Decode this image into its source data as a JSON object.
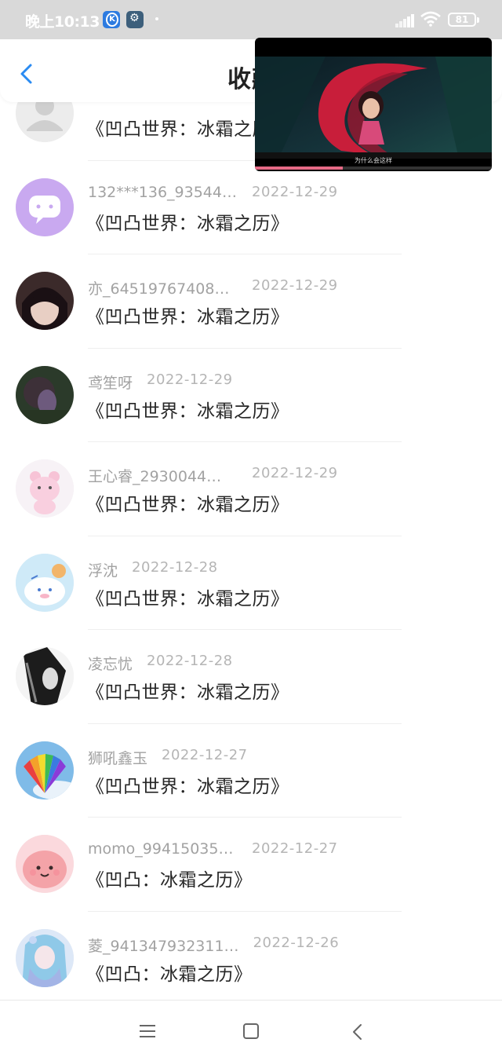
{
  "status_bar": {
    "time": "晚上10:13",
    "battery": "81",
    "icons": [
      "k-app-icon",
      "gear-app-icon",
      "dot-icon",
      "signal-icon",
      "wifi-icon",
      "battery-icon"
    ]
  },
  "header": {
    "title": "收藏",
    "back_icon": "chevron-left-icon"
  },
  "video": {
    "caption": "为什么会这样",
    "progress": 0.37
  },
  "list": [
    {
      "name": "",
      "date": "",
      "title": "《凹凸世界：冰霜之历》",
      "avatar": "default-avatar"
    },
    {
      "name": "132***136_93544…",
      "date": "2022-12-29",
      "title": "《凹凸世界：冰霜之历》",
      "avatar": "purple-chat-avatar"
    },
    {
      "name": "亦_64519767408…",
      "date": "2022-12-29",
      "title": "《凹凸世界：冰霜之历》",
      "avatar": "anime-boy-avatar"
    },
    {
      "name": "鸢笙呀",
      "date": "2022-12-29",
      "title": "《凹凸世界：冰霜之历》",
      "avatar": "dark-photo-avatar"
    },
    {
      "name": "王心睿_2930044…",
      "date": "2022-12-29",
      "title": "《凹凸世界：冰霜之历》",
      "avatar": "pink-bear-avatar"
    },
    {
      "name": "浮沈",
      "date": "2022-12-28",
      "title": "《凹凸世界：冰霜之历》",
      "avatar": "cinnamoroll-avatar"
    },
    {
      "name": "凌忘忧",
      "date": "2022-12-28",
      "title": "《凹凸世界：冰霜之历》",
      "avatar": "anime-girl-avatar"
    },
    {
      "name": "狮吼鑫玉",
      "date": "2022-12-27",
      "title": "《凹凸世界：冰霜之历》",
      "avatar": "rainbow-fan-avatar"
    },
    {
      "name": "momo_99415035…",
      "date": "2022-12-27",
      "title": "《凹凸：冰霜之历》",
      "avatar": "pink-blob-avatar"
    },
    {
      "name": "菱_941347932311…",
      "date": "2022-12-26",
      "title": "《凹凸：冰霜之历》",
      "avatar": "blue-anime-avatar"
    }
  ],
  "nav": {
    "icons": [
      "menu-icon",
      "home-square-icon",
      "back-triangle-icon"
    ]
  },
  "colors": {
    "accent": "#2a8bf2",
    "status_bar_bg": "#d9d9d9",
    "meta_text": "#a2a2a2",
    "title_text": "#262626"
  }
}
